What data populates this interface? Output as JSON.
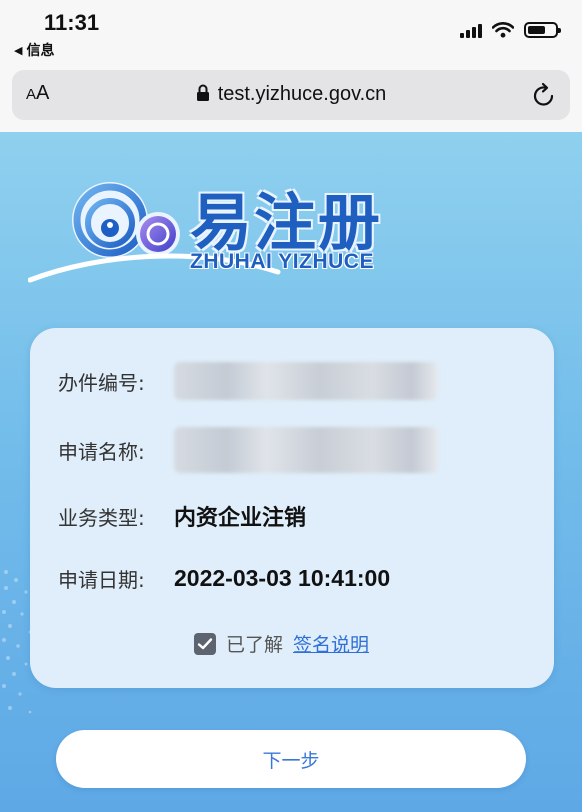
{
  "status_bar": {
    "time": "11:31",
    "back_label": "信息"
  },
  "browser": {
    "text_size_label_small": "A",
    "text_size_label_large": "A",
    "url": "test.yizhuce.gov.cn"
  },
  "brand": {
    "name_cn": "易注册",
    "name_en": "ZHUHAI YIZHUCE"
  },
  "form": {
    "rows": [
      {
        "label": "办件编号:",
        "value": ""
      },
      {
        "label": "申请名称:",
        "value": ""
      },
      {
        "label": "业务类型:",
        "value": "内资企业注销"
      },
      {
        "label": "申请日期:",
        "value": "2022-03-03 10:41:00"
      }
    ],
    "agree_text": "已了解",
    "agree_link": "签名说明",
    "agree_checked": true
  },
  "next_button_label": "下一步",
  "colors": {
    "background_top": "#8fd0ee",
    "background_bottom": "#5ea8e6",
    "brand_blue": "#1f5fc0",
    "link_blue": "#2f6fd6",
    "card_bg": "#dfeefa"
  }
}
